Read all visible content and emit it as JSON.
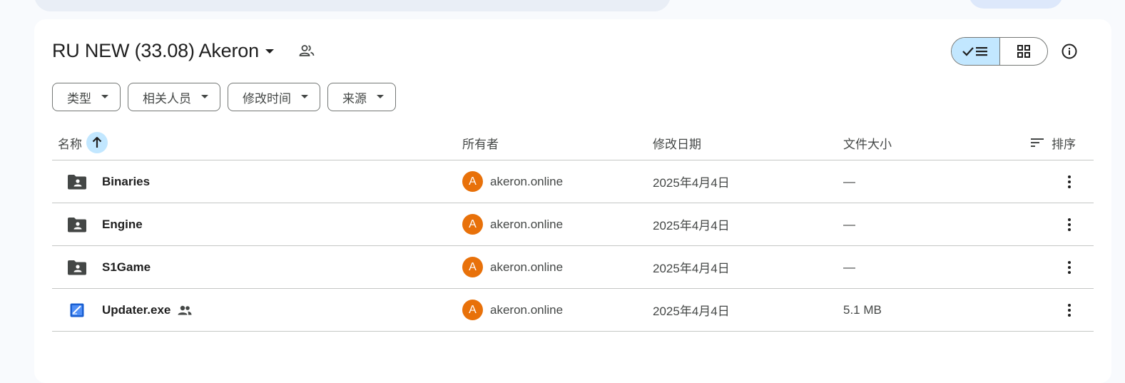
{
  "folder": {
    "title": "RU NEW (33.08) Akeron"
  },
  "filters": [
    {
      "label": "类型"
    },
    {
      "label": "相关人员"
    },
    {
      "label": "修改时间"
    },
    {
      "label": "来源"
    }
  ],
  "columns": {
    "name": "名称",
    "owner": "所有者",
    "modified": "修改日期",
    "size": "文件大小",
    "sort": "排序"
  },
  "files": [
    {
      "name": "Binaries",
      "type": "shared-folder",
      "owner_initial": "A",
      "owner": "akeron.online",
      "modified": "2025年4月4日",
      "size": "—",
      "shared": false
    },
    {
      "name": "Engine",
      "type": "shared-folder",
      "owner_initial": "A",
      "owner": "akeron.online",
      "modified": "2025年4月4日",
      "size": "—",
      "shared": false
    },
    {
      "name": "S1Game",
      "type": "shared-folder",
      "owner_initial": "A",
      "owner": "akeron.online",
      "modified": "2025年4月4日",
      "size": "—",
      "shared": false
    },
    {
      "name": "Updater.exe",
      "type": "executable",
      "owner_initial": "A",
      "owner": "akeron.online",
      "modified": "2025年4月4日",
      "size": "5.1 MB",
      "shared": true
    }
  ],
  "colors": {
    "accent": "#c2e7ff",
    "avatar": "#e8710a",
    "text": "#1f1f1f",
    "muted": "#444746"
  }
}
